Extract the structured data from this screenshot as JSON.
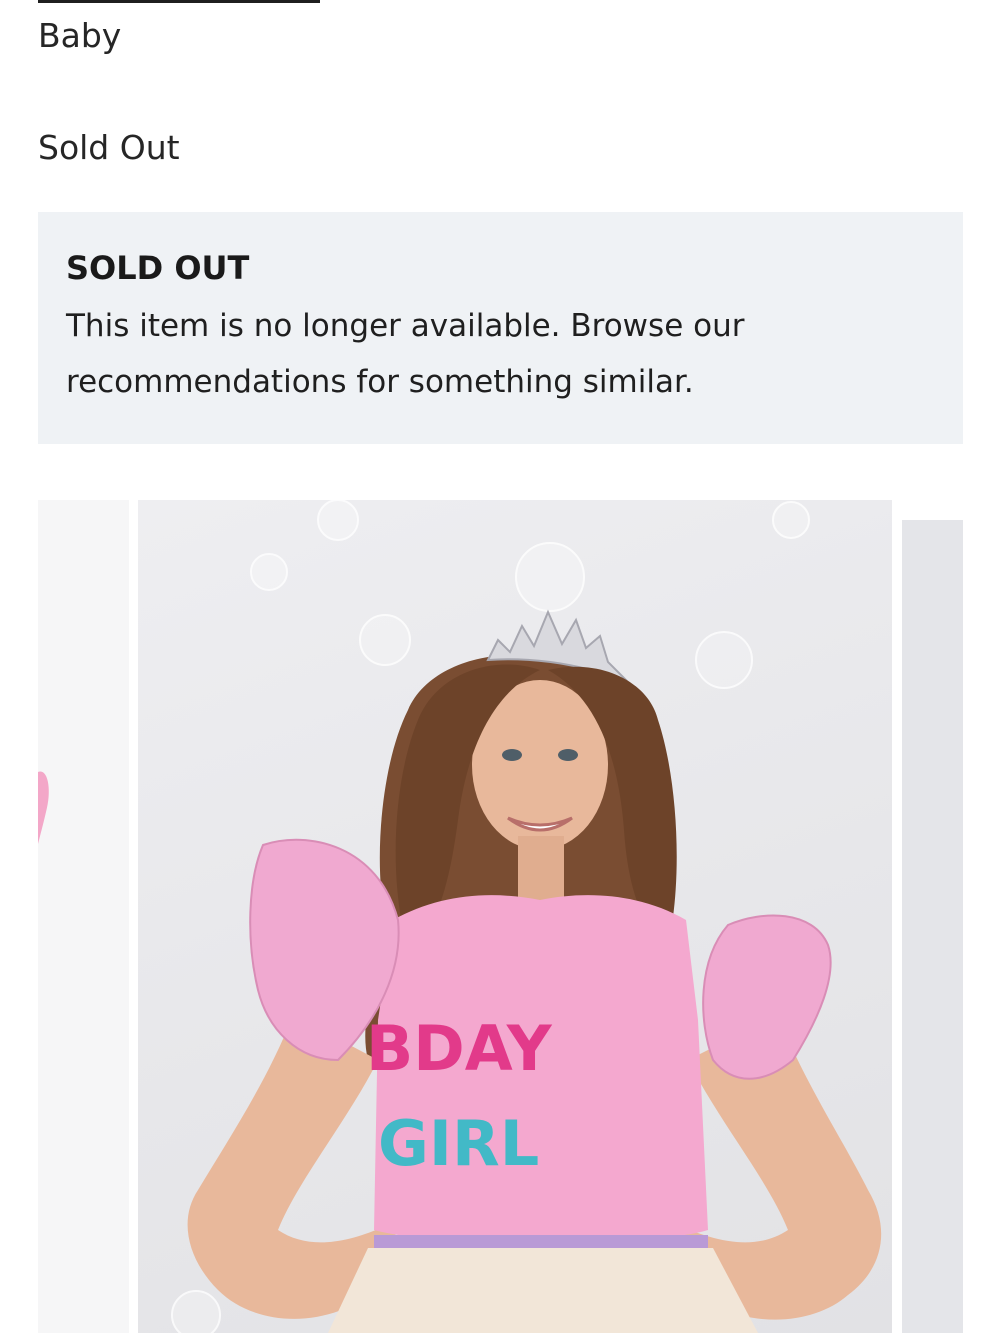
{
  "product": {
    "category": "Baby",
    "stock_status": "Sold Out"
  },
  "notice": {
    "title": "SOLD OUT",
    "message": "This item is no longer available. Browse our recommendations for something similar."
  },
  "carousel": {
    "main_image_alt": "Girl wearing a tiara and pink ruffle-sleeve BDAY GIRL tee",
    "shirt_text_line1": "BDAY",
    "shirt_text_line2": "GIRL"
  },
  "colors": {
    "notice_background": "#eff2f5",
    "shirt_pink": "#f4a8cf",
    "photo_background": "#e9e9ec"
  }
}
